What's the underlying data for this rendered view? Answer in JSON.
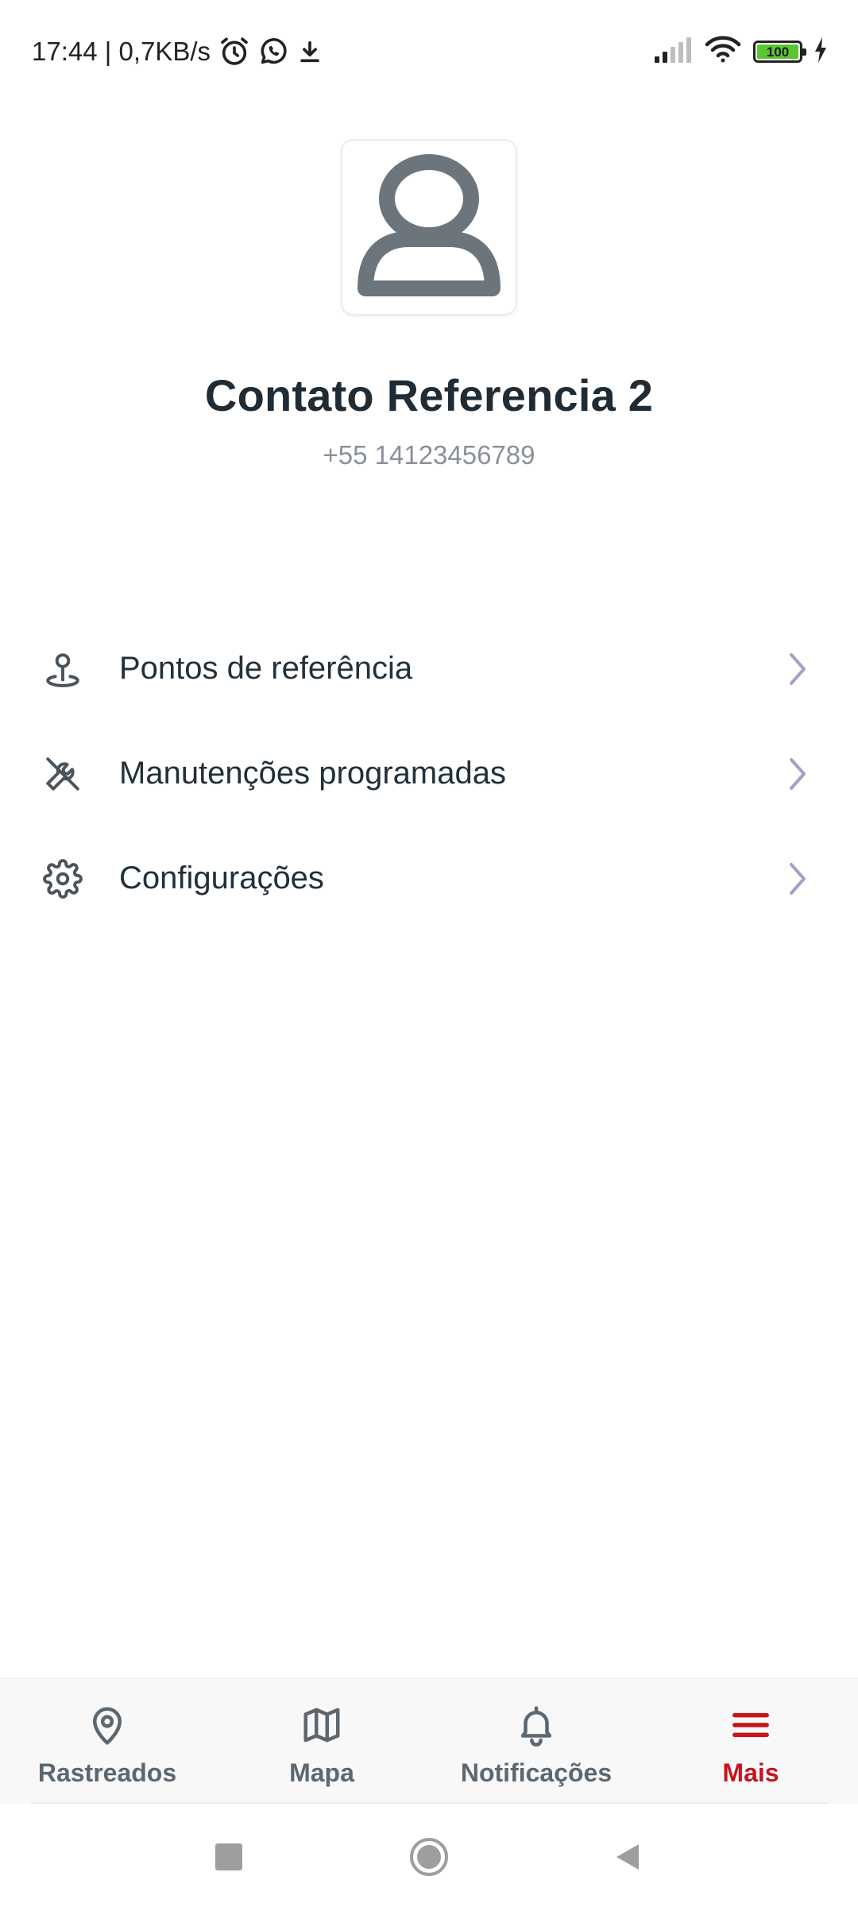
{
  "status_bar": {
    "time_speed": "17:44 | 0,7KB/s",
    "battery_level": "100",
    "icons": [
      "alarm-icon",
      "whatsapp-icon",
      "download-icon",
      "signal-icon",
      "wifi-icon",
      "battery-icon",
      "charging-icon"
    ]
  },
  "profile": {
    "name": "Contato Referencia 2",
    "phone": "+55 14123456789",
    "avatar_icon": "user-icon"
  },
  "menu": {
    "items": [
      {
        "label": "Pontos de referência",
        "icon": "map-pin-icon"
      },
      {
        "label": "Manutenções programadas",
        "icon": "wrench-icon"
      },
      {
        "label": "Configurações",
        "icon": "gear-icon"
      }
    ],
    "chevron_color": "#a79fc6"
  },
  "bottom_nav": {
    "items": [
      {
        "label": "Rastreados",
        "icon": "location-pin-icon",
        "active": false
      },
      {
        "label": "Mapa",
        "icon": "map-icon",
        "active": false
      },
      {
        "label": "Notificações",
        "icon": "bell-icon",
        "active": false
      },
      {
        "label": "Mais",
        "icon": "menu-icon",
        "active": true
      }
    ],
    "active_color": "#c4161c",
    "inactive_color": "#5d6770"
  },
  "system_nav": {
    "buttons": [
      "recents-button",
      "home-button",
      "back-button"
    ]
  }
}
